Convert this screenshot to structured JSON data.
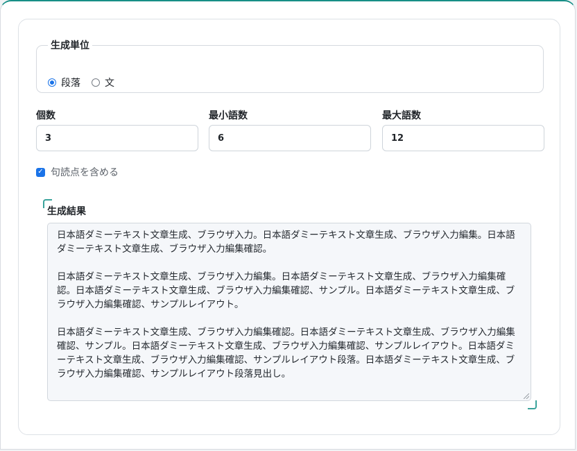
{
  "unit": {
    "legend": "生成単位",
    "options": [
      {
        "label": "段落",
        "checked": true
      },
      {
        "label": "文",
        "checked": false
      }
    ]
  },
  "fields": {
    "count_label": "個数",
    "count_value": "3",
    "min_label": "最小語数",
    "min_value": "6",
    "max_label": "最大語数",
    "max_value": "12"
  },
  "punctuation": {
    "label": "句読点を含める",
    "checked": true
  },
  "result": {
    "label": "生成結果",
    "paragraphs": [
      "日本語ダミーテキスト文章生成、ブラウザ入力。日本語ダミーテキスト文章生成、ブラウザ入力編集。日本語ダミーテキスト文章生成、ブラウザ入力編集確認。",
      "日本語ダミーテキスト文章生成、ブラウザ入力編集。日本語ダミーテキスト文章生成、ブラウザ入力編集確認。日本語ダミーテキスト文章生成、ブラウザ入力編集確認、サンプル。日本語ダミーテキスト文章生成、ブラウザ入力編集確認、サンプルレイアウト。",
      "日本語ダミーテキスト文章生成、ブラウザ入力編集確認。日本語ダミーテキスト文章生成、ブラウザ入力編集確認、サンプル。日本語ダミーテキスト文章生成、ブラウザ入力編集確認、サンプルレイアウト。日本語ダミーテキスト文章生成、ブラウザ入力編集確認、サンプルレイアウト段落。日本語ダミーテキスト文章生成、ブラウザ入力編集確認、サンプルレイアウト段落見出し。"
    ]
  },
  "colors": {
    "accent": "#1a73e8",
    "window_top": "#178f86",
    "focus_corner": "#3aa39b"
  }
}
